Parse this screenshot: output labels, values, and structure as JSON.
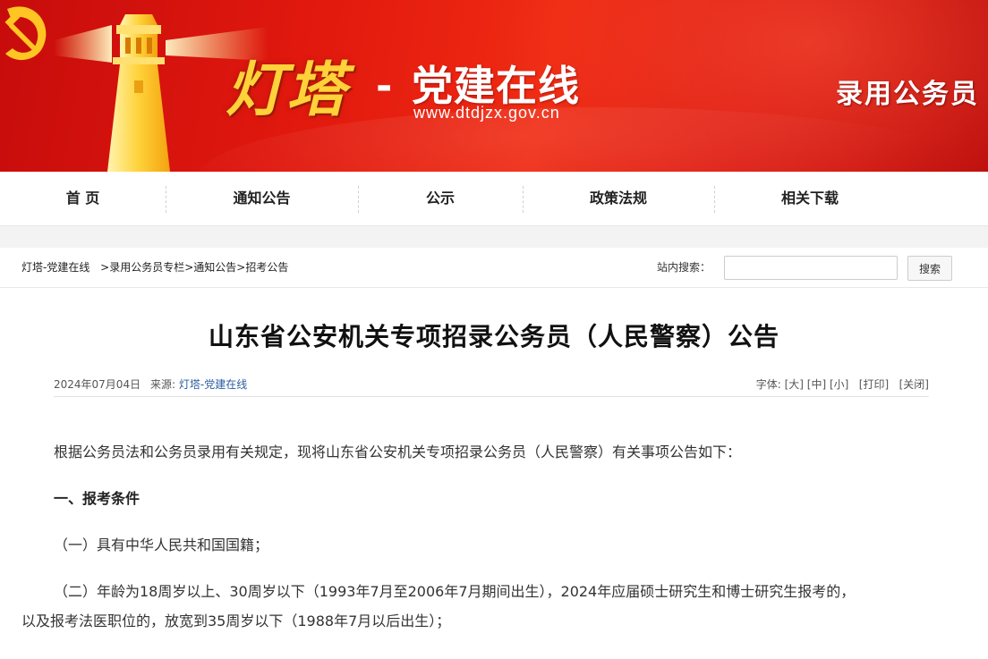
{
  "banner": {
    "logo_main": "灯塔",
    "logo_dash": "-",
    "logo_sub": "党建在线",
    "logo_url": "www.dtdjzx.gov.cn",
    "section_title": "录用公务员",
    "colors": {
      "primary_red": "#d81510",
      "gold": "#ffd23a"
    }
  },
  "nav": {
    "items": [
      {
        "label": "首 页"
      },
      {
        "label": "通知公告"
      },
      {
        "label": "公示"
      },
      {
        "label": "政策法规"
      },
      {
        "label": "相关下载"
      }
    ]
  },
  "breadcrumb": {
    "items": [
      "灯塔-党建在线",
      ">录用公务员专栏",
      ">通知公告",
      ">招考公告"
    ]
  },
  "search": {
    "label": "站内搜索：",
    "placeholder": "",
    "button_label": "搜索"
  },
  "article": {
    "title": "山东省公安机关专项招录公务员（人民警察）公告",
    "date": "2024年07月04日",
    "source_label": "来源:",
    "source_name": "灯塔-党建在线",
    "tools": {
      "font_label": "字体:",
      "large": "[大]",
      "medium": "[中]",
      "small": "[小]",
      "print": "[打印]",
      "close": "[关闭]"
    },
    "paragraphs": {
      "intro": "根据公务员法和公务员录用有关规定，现将山东省公安机关专项招录公务员（人民警察）有关事项公告如下：",
      "section1": "一、报考条件",
      "item1": "（一）具有中华人民共和国国籍；",
      "item2_line1": "（二）年龄为18周岁以上、30周岁以下（1993年7月至2006年7月期间出生），2024年应届硕士研究生和博士研究生报考的，",
      "item2_line2": "以及报考法医职位的，放宽到35周岁以下（1988年7月以后出生）；"
    }
  }
}
